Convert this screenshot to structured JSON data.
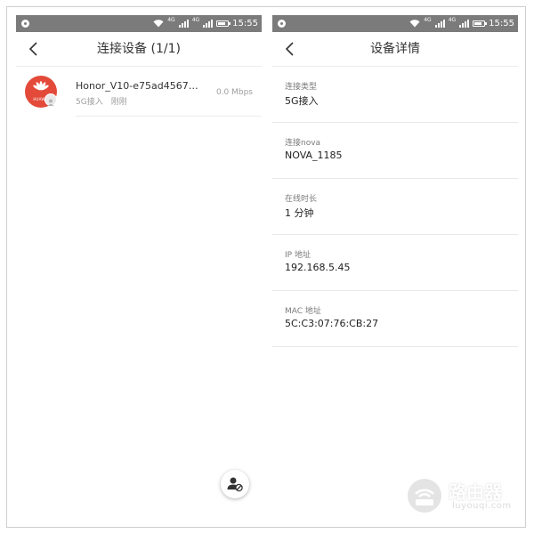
{
  "status_bar": {
    "signal_tag_1": "4G",
    "signal_tag_2": "4G",
    "time": "15:55"
  },
  "left_screen": {
    "title": "连接设备 (1/1)",
    "device": {
      "avatar_text": "HUAWEI",
      "name": "Honor_V10-e75ad4567…",
      "connection": "5G接入",
      "time": "刚刚",
      "speed": "0.0 Mbps"
    },
    "fab_icon": "block-user-icon"
  },
  "right_screen": {
    "title": "设备详情",
    "details": [
      {
        "label": "连接类型",
        "value": "5G接入"
      },
      {
        "label": "连接nova",
        "value": "NOVA_1185"
      },
      {
        "label": "在线时长",
        "value": "1 分钟"
      },
      {
        "label": "IP 地址",
        "value": "192.168.5.45"
      },
      {
        "label": "MAC 地址",
        "value": "5C:C3:07:76:CB:27"
      }
    ]
  },
  "watermark": {
    "title": "路由器",
    "subtitle": "luyouqi.com"
  },
  "colors": {
    "status_bar": "#7b7b7b",
    "huawei_red": "#e34a3a",
    "divider": "#ececec"
  }
}
